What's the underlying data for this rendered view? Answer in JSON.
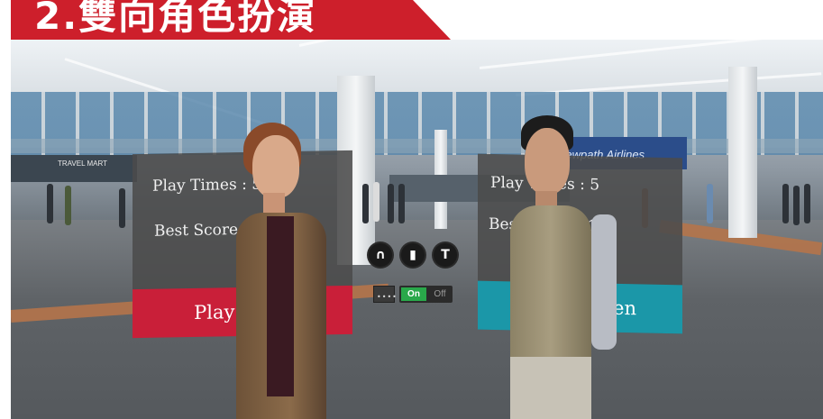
{
  "banner": {
    "title": "2.雙向角色扮演"
  },
  "scene": {
    "signs": {
      "left_store": "TRAVEL MART",
      "airline": "Newpath Airlines"
    }
  },
  "panels": {
    "katie": {
      "play_times": "Play Times : 5",
      "best_score": "Best Score : 100",
      "button_label": "Play Katie",
      "button_color": "#c91f39"
    },
    "steven": {
      "play_times": "Play Times : 5",
      "best_score": "Best Score : 100",
      "button_label": "Play Steven",
      "button_color": "#1b97a8"
    }
  },
  "controls": {
    "icons": [
      "headphones-icon",
      "book-icon",
      "text-icon"
    ],
    "icon_glyphs": {
      "headphones": "∩",
      "book": "▮",
      "text": "T"
    },
    "toggle": {
      "on_label": "On",
      "off_label": "Off",
      "state": "On",
      "on_color": "#29a84a"
    },
    "swatch_dots": "••••"
  }
}
